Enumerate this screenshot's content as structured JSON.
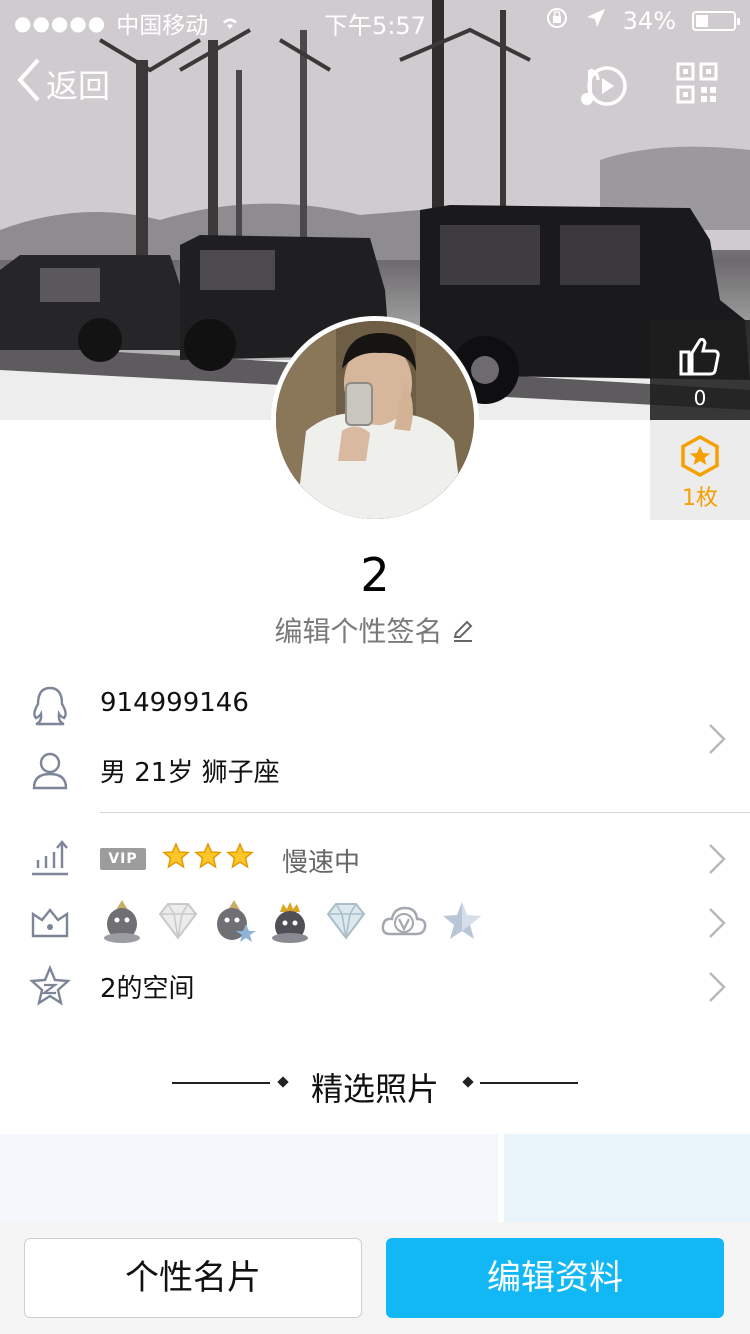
{
  "status_bar": {
    "signal_dots": "●●●●●",
    "carrier": "中国移动",
    "time": "下午5:57",
    "battery_percent": "34%",
    "battery_level": 0.34
  },
  "nav": {
    "back_label": "返回",
    "icons": [
      "chevron-left-icon",
      "music-play-icon",
      "qr-code-icon"
    ]
  },
  "side_panel": {
    "likes_count": "0",
    "badge_count": "1枚"
  },
  "profile": {
    "username": "2",
    "signature_prompt": "编辑个性签名"
  },
  "info": {
    "qq_number": "914999146",
    "basic": "男 21岁 狮子座"
  },
  "level": {
    "vip_label": "VIP",
    "star_count": 3,
    "speed_status": "慢速中"
  },
  "badges": [
    "penguin-crown-icon",
    "diamond-icon",
    "penguin-star-icon",
    "penguin-king-icon",
    "diamond-blue-icon",
    "cloud-v-icon",
    "star-icon"
  ],
  "space": {
    "label": "2的空间"
  },
  "featured": {
    "title": "精选照片"
  },
  "buttons": {
    "card_label": "个性名片",
    "edit_label": "编辑资料"
  },
  "colors": {
    "accent_blue": "#12b7f5",
    "badge_gold": "#f5a000"
  }
}
